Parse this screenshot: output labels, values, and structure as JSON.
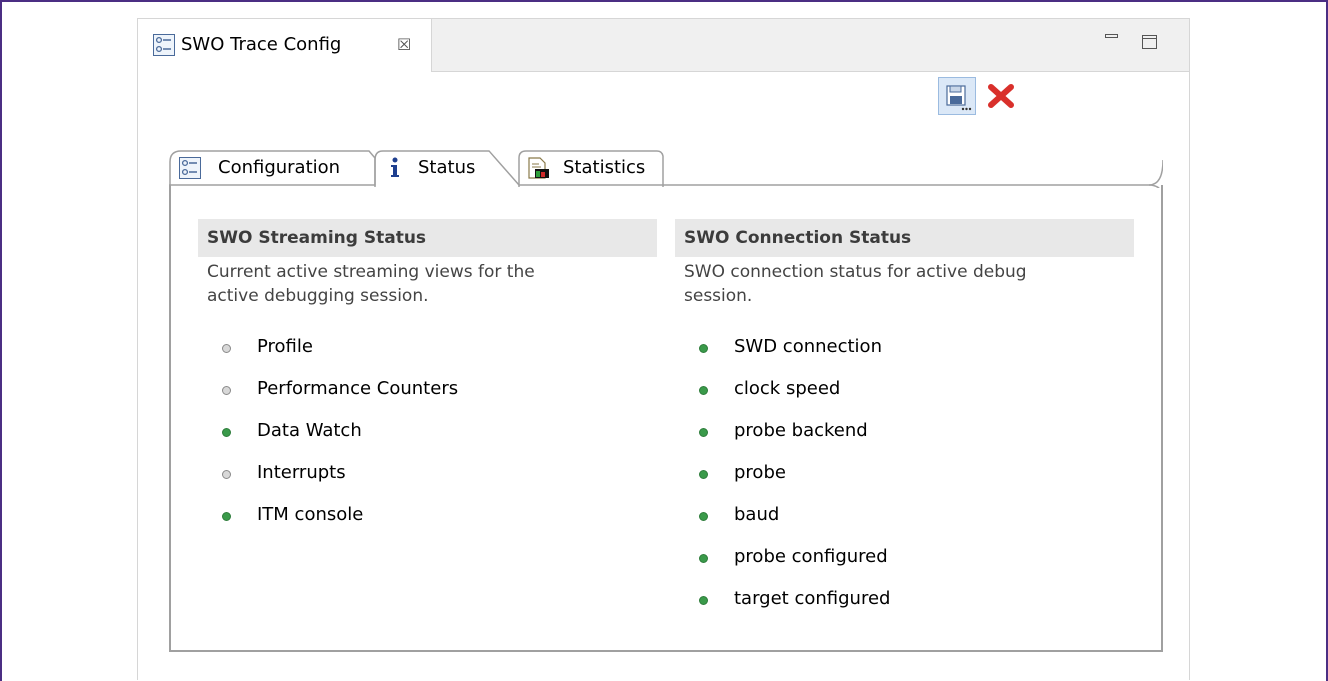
{
  "view": {
    "title": "SWO Trace Config",
    "close_glyph": "☒"
  },
  "toolbar": {
    "save_icon": "save-icon",
    "remove_icon": "remove-icon"
  },
  "tabs": [
    {
      "label": "Configuration",
      "icon": "configuration-icon",
      "selected": false
    },
    {
      "label": "Status",
      "icon": "info-icon",
      "selected": true
    },
    {
      "label": "Statistics",
      "icon": "statistics-icon",
      "selected": false
    }
  ],
  "streaming": {
    "header": "SWO Streaming Status",
    "desc_line1": "Current active streaming views for the",
    "desc_line2": "active debugging session.",
    "items": [
      {
        "label": "Profile",
        "active": false
      },
      {
        "label": "Performance Counters",
        "active": false
      },
      {
        "label": "Data Watch",
        "active": true
      },
      {
        "label": "Interrupts",
        "active": false
      },
      {
        "label": "ITM console",
        "active": true
      }
    ]
  },
  "connection": {
    "header": "SWO Connection Status",
    "desc_line1": "SWO connection status for active debug",
    "desc_line2": "session.",
    "items": [
      {
        "label": "SWD connection",
        "active": true
      },
      {
        "label": "clock speed",
        "active": true
      },
      {
        "label": "probe backend",
        "active": true
      },
      {
        "label": "probe",
        "active": true
      },
      {
        "label": "baud",
        "active": true
      },
      {
        "label": "probe configured",
        "active": true
      },
      {
        "label": "target configured",
        "active": true
      }
    ]
  },
  "colors": {
    "active": "#3a9a4a",
    "inactive": "#d8d8d8",
    "frame": "#4b2e83"
  }
}
